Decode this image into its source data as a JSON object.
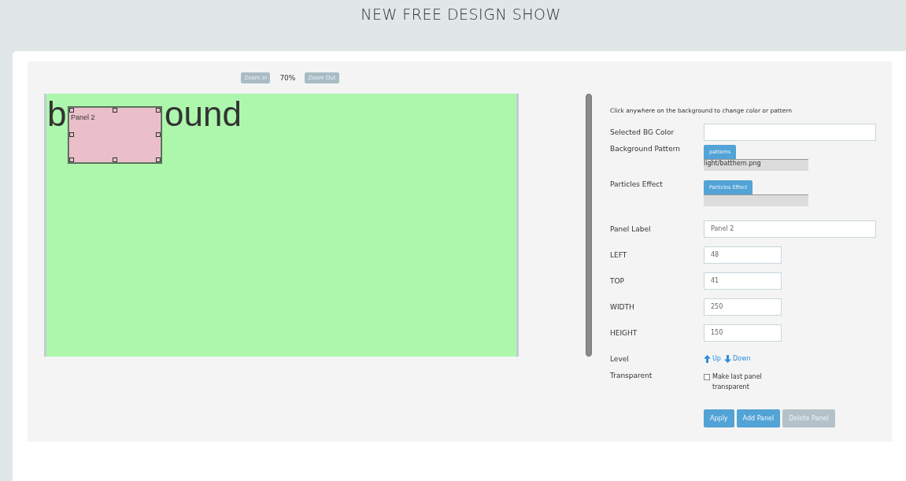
{
  "header": {
    "title": "NEW FREE DESIGN SHOW"
  },
  "zoom": {
    "zoom_in": "Zoom In",
    "percent": "70%",
    "zoom_out": "Zoom Out"
  },
  "canvas": {
    "text_parts": [
      "b",
      "ound"
    ],
    "panel": {
      "label": "Panel 2",
      "selected": true
    }
  },
  "form": {
    "hint": "Click anywhere on the background to change color or pattern",
    "bg_color": {
      "label": "Selected BG Color"
    },
    "pattern": {
      "label": "Background Pattern",
      "button": "patterns",
      "value": "light/batthern.png"
    },
    "particles": {
      "label": "Particles Effect",
      "button": "Particles Effect"
    },
    "panel_label": {
      "label": "Panel Label",
      "value": "Panel 2"
    },
    "numbers": [
      {
        "label": "LEFT",
        "value": "48"
      },
      {
        "label": "TOP",
        "value": "41"
      },
      {
        "label": "WIDTH",
        "value": "250"
      },
      {
        "label": "HEIGHT",
        "value": "150"
      }
    ],
    "level": {
      "label": "Level",
      "up": "Up",
      "down": "Down"
    },
    "transparent": {
      "label": "Transparent",
      "checkbox": "Make last panel transparent",
      "checked": false
    },
    "buttons": [
      {
        "label": "Apply",
        "disabled": false
      },
      {
        "label": "Add Panel",
        "disabled": false
      },
      {
        "label": "Delete Panel",
        "disabled": true
      }
    ]
  }
}
